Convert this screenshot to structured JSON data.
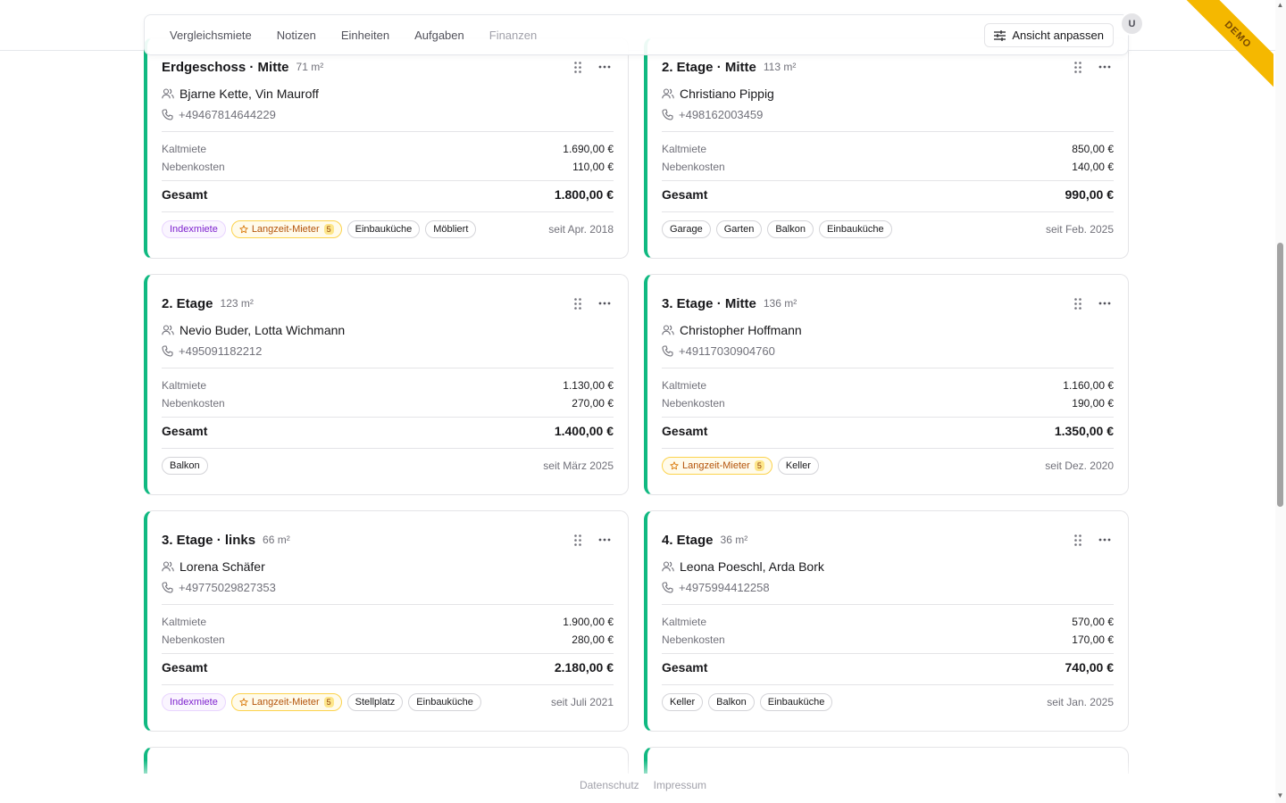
{
  "toolbar": {
    "tabs": [
      "Vergleichsmiete",
      "Notizen",
      "Einheiten",
      "Aufgaben",
      "Finanzen"
    ],
    "customize_label": "Ansicht anpassen",
    "avatar_initial": "U"
  },
  "ribbon": "DEMO",
  "labels": {
    "kaltmiete": "Kaltmiete",
    "nebenkosten": "Nebenkosten",
    "gesamt": "Gesamt"
  },
  "units": [
    {
      "title": "Erdgeschoss · Mitte",
      "area": "71 m²",
      "tenants": "Bjarne Kette, Vin Mauroff",
      "phone": "+49467814644229",
      "kaltmiete": "1.690,00 €",
      "nebenkosten": "110,00 €",
      "gesamt": "1.800,00 €",
      "tags": [
        {
          "label": "Indexmiete",
          "style": "purple"
        },
        {
          "label": "Langzeit-Mieter",
          "style": "orange",
          "count": "5"
        },
        {
          "label": "Einbauküche"
        },
        {
          "label": "Möbliert"
        }
      ],
      "since": "seit Apr. 2018"
    },
    {
      "title": "2. Etage · Mitte",
      "area": "113 m²",
      "tenants": "Christiano Pippig",
      "phone": "+498162003459",
      "kaltmiete": "850,00 €",
      "nebenkosten": "140,00 €",
      "gesamt": "990,00 €",
      "tags": [
        {
          "label": "Garage"
        },
        {
          "label": "Garten"
        },
        {
          "label": "Balkon"
        },
        {
          "label": "Einbauküche"
        }
      ],
      "since": "seit Feb. 2025"
    },
    {
      "title": "2. Etage",
      "area": "123 m²",
      "tenants": "Nevio Buder, Lotta Wichmann",
      "phone": "+495091182212",
      "kaltmiete": "1.130,00 €",
      "nebenkosten": "270,00 €",
      "gesamt": "1.400,00 €",
      "tags": [
        {
          "label": "Balkon"
        }
      ],
      "since": "seit März 2025"
    },
    {
      "title": "3. Etage · Mitte",
      "area": "136 m²",
      "tenants": "Christopher Hoffmann",
      "phone": "+49117030904760",
      "kaltmiete": "1.160,00 €",
      "nebenkosten": "190,00 €",
      "gesamt": "1.350,00 €",
      "tags": [
        {
          "label": "Langzeit-Mieter",
          "style": "orange",
          "count": "5"
        },
        {
          "label": "Keller"
        }
      ],
      "since": "seit Dez. 2020"
    },
    {
      "title": "3. Etage · links",
      "area": "66 m²",
      "tenants": "Lorena Schäfer",
      "phone": "+49775029827353",
      "kaltmiete": "1.900,00 €",
      "nebenkosten": "280,00 €",
      "gesamt": "2.180,00 €",
      "tags": [
        {
          "label": "Indexmiete",
          "style": "purple"
        },
        {
          "label": "Langzeit-Mieter",
          "style": "orange",
          "count": "5"
        },
        {
          "label": "Stellplatz"
        },
        {
          "label": "Einbauküche"
        }
      ],
      "since": "seit Juli 2021"
    },
    {
      "title": "4. Etage",
      "area": "36 m²",
      "tenants": "Leona Poeschl, Arda Bork",
      "phone": "+4975994412258",
      "kaltmiete": "570,00 €",
      "nebenkosten": "170,00 €",
      "gesamt": "740,00 €",
      "tags": [
        {
          "label": "Keller"
        },
        {
          "label": "Balkon"
        },
        {
          "label": "Einbauküche"
        }
      ],
      "since": "seit Jan. 2025"
    }
  ],
  "footer": {
    "privacy": "Datenschutz",
    "imprint": "Impressum"
  }
}
